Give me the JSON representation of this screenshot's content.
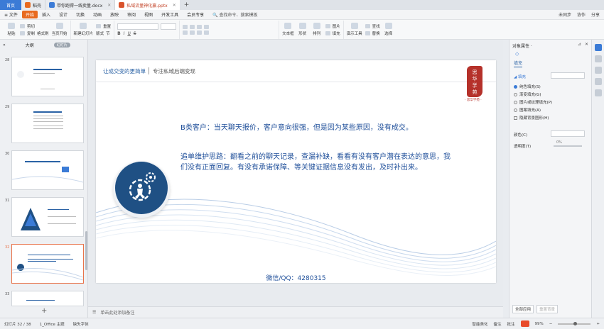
{
  "titlebar": {
    "home_tab": "首页",
    "tabs": [
      {
        "label": "稻壳",
        "color": "#e86a1f"
      },
      {
        "label": "带你跑得一线卖量.docx",
        "color": "#3b7bd6"
      },
      {
        "label": "私域流量神化赢.pptx",
        "color": "#d9532c"
      }
    ],
    "new_tab": "+"
  },
  "menubar": {
    "file": "≡ 文件",
    "items": [
      "开始",
      "插入",
      "设计",
      "切换",
      "动画",
      "放映",
      "审阅",
      "视图",
      "开发工具",
      "会员专享"
    ],
    "search": "查找命令、搜索模板",
    "right": [
      "未同步",
      "协作",
      "分享"
    ]
  },
  "ribbon": {
    "paste": "粘贴",
    "cut": "剪切",
    "copy": "复制",
    "format_painter": "格式刷",
    "play_from_current": "当页开始",
    "new_slide": "新建幻灯片",
    "layout": "版式",
    "section": "节",
    "reset": "重置",
    "bold": "B",
    "italic": "I",
    "underline": "U",
    "strike": "S",
    "textbox": "文本框",
    "shape": "形状",
    "arrange": "排列",
    "picture": "图片",
    "fill": "填充",
    "present_tools": "演示工具",
    "find": "查找",
    "replace": "替换",
    "select": "选择"
  },
  "leftpanel": {
    "outline": "大纲",
    "toggle": "幻灯片",
    "slides": [
      {
        "num": "28"
      },
      {
        "num": "29"
      },
      {
        "num": "30"
      },
      {
        "num": "31"
      },
      {
        "num": "32"
      },
      {
        "num": "33"
      }
    ],
    "add": "+"
  },
  "slide": {
    "header_left": "让成交变的更简单",
    "header_right": "专注私域后端变现",
    "seal_text": "思 华 学 苑",
    "seal_sub": "· 思华学苑 ·",
    "paragraph1": "B类客户：当天聊天报价，客户意向很强，但是因为某些原因，没有成交。",
    "paragraph2": "追单维护思路：翻看之前的聊天记录，查漏补缺，看看有没有客户潜在表达的意思，我们没有正面回复。有没有承诺保障、等关键证据信息没有发出，及时补出来。",
    "wechat": "微信/QQ：4280315",
    "accent_color": "#1f5084"
  },
  "notes": {
    "placeholder": "单击此处添加备注"
  },
  "rightpanel": {
    "title": "对象属性 ·",
    "tab": "填充",
    "section": "◢ 填充",
    "options": [
      {
        "label": "纯色填充(S)",
        "checked": true
      },
      {
        "label": "渐变填充(G)",
        "checked": false
      },
      {
        "label": "图片或纹理填充(P)",
        "checked": false
      },
      {
        "label": "图案填充(A)",
        "checked": false
      }
    ],
    "hide_bg": "隐藏背景图形(H)",
    "color_label": "颜色(C)",
    "transparency_label": "透明度(T)",
    "transparency_value": "0%",
    "apply_all": "全部应用",
    "reset_bg": "重置背景"
  },
  "statusbar": {
    "slide_info": "幻灯片 32 / 38",
    "theme": "1_Office 主题",
    "font_missing": "缺失字体",
    "beautify": "智能美化",
    "notes": "备注",
    "comments": "批注",
    "zoom": "99%"
  }
}
